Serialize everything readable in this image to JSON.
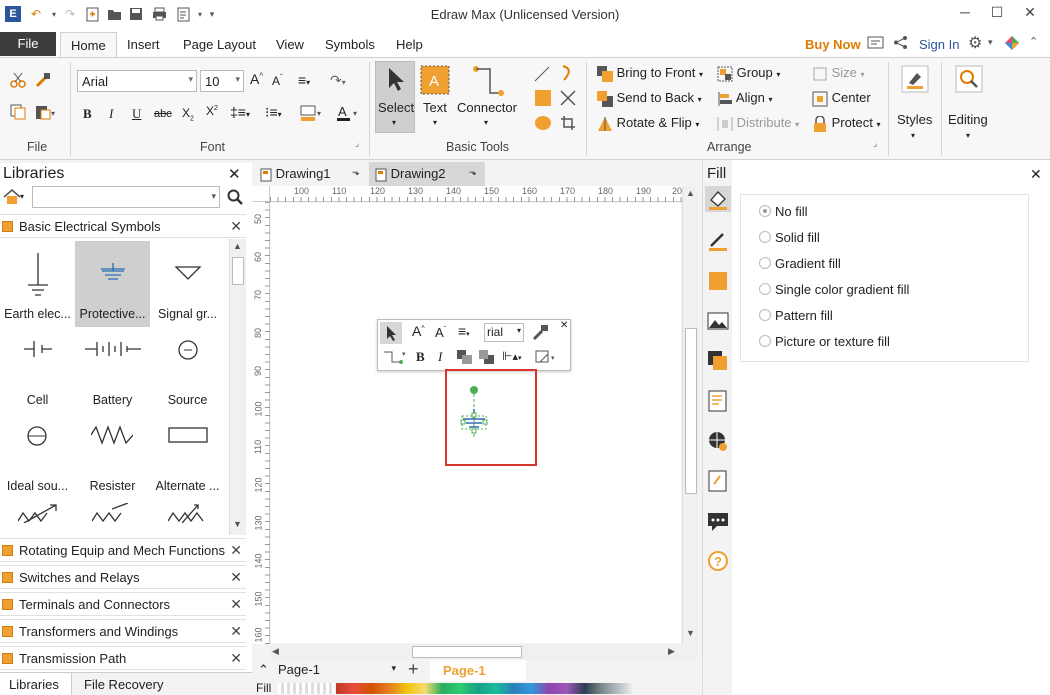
{
  "window": {
    "title": "Edraw Max (Unlicensed Version)"
  },
  "menu": {
    "file": "File",
    "tabs": [
      "Home",
      "Insert",
      "Page Layout",
      "View",
      "Symbols",
      "Help"
    ],
    "buy_now": "Buy Now",
    "sign_in": "Sign In"
  },
  "ribbon": {
    "file_group": "File",
    "font_group": "Font",
    "font_name": "Arial",
    "font_size": "10",
    "basic_tools_group": "Basic Tools",
    "select": "Select",
    "text": "Text",
    "connector": "Connector",
    "arrange_group": "Arrange",
    "bring_to_front": "Bring to Front",
    "send_to_back": "Send to Back",
    "rotate_flip": "Rotate & Flip",
    "group": "Group",
    "align": "Align",
    "distribute": "Distribute",
    "size": "Size",
    "center": "Center",
    "protect": "Protect",
    "styles": "Styles",
    "editing": "Editing"
  },
  "libraries": {
    "title": "Libraries",
    "open_library": "Basic Electrical Symbols",
    "shapes": [
      {
        "name": "Earth elec..."
      },
      {
        "name": "Protective..."
      },
      {
        "name": "Signal gr..."
      },
      {
        "name": "Cell"
      },
      {
        "name": "Battery"
      },
      {
        "name": "Source"
      },
      {
        "name": "Ideal sou..."
      },
      {
        "name": "Resister"
      },
      {
        "name": "Alternate ..."
      }
    ],
    "collapsed": [
      "Rotating Equip and Mech Functions",
      "Switches and Relays",
      "Terminals and Connectors",
      "Transformers and Windings",
      "Transmission Path"
    ],
    "bottom_tabs": [
      "Libraries",
      "File Recovery"
    ]
  },
  "documents": {
    "tabs": [
      "Drawing1",
      "Drawing2"
    ],
    "ruler_h": [
      "100",
      "110",
      "120",
      "130",
      "140",
      "150",
      "160",
      "170",
      "180",
      "190",
      "20"
    ],
    "ruler_v": [
      "50",
      "60",
      "70",
      "80",
      "90",
      "100",
      "110",
      "120",
      "130",
      "140",
      "150",
      "160"
    ],
    "floatbar_font": "rial",
    "page_select": "Page-1",
    "page_tab": "Page-1",
    "fill_label": "Fill"
  },
  "fill_panel": {
    "title": "Fill",
    "options": [
      "No fill",
      "Solid fill",
      "Gradient fill",
      "Single color gradient fill",
      "Pattern fill",
      "Picture or texture fill"
    ],
    "selected": "No fill"
  },
  "colors": {
    "accent": "#f0a030",
    "buy_now": "#e07b00",
    "page_tab": "#f0a030",
    "highlight_box": "#d9342b",
    "selected_shape_bg": "#cfcfcf"
  }
}
